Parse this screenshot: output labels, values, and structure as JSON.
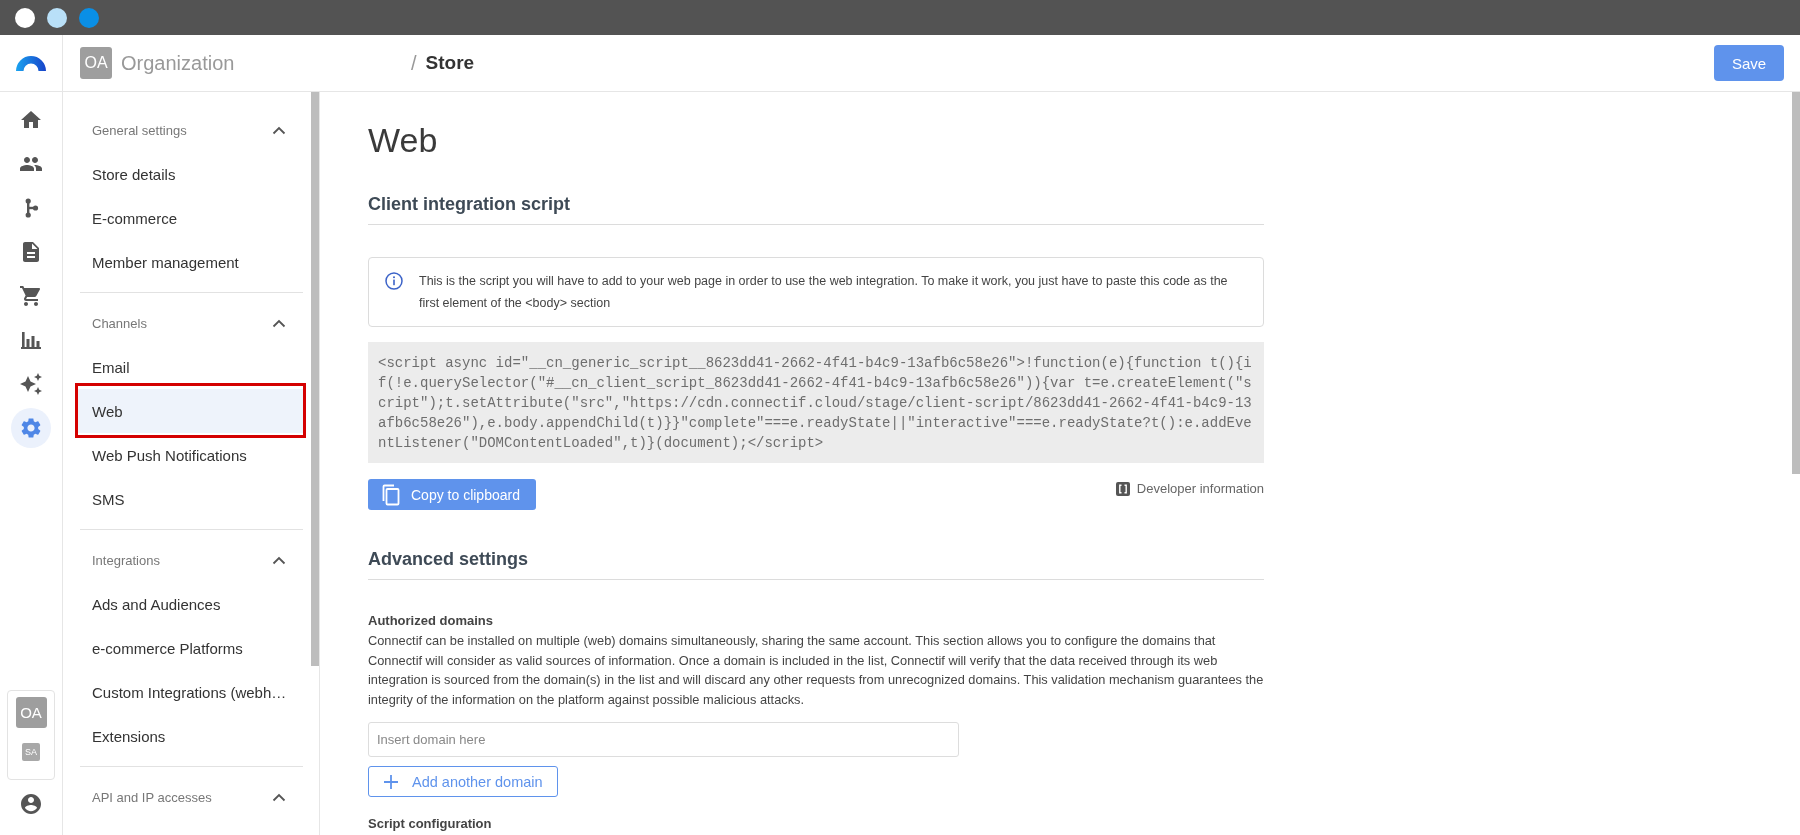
{
  "window": {
    "controls": [
      {
        "color": "#ffffff"
      },
      {
        "color": "#b9e0f8"
      },
      {
        "color": "#0a8fe6"
      }
    ]
  },
  "nav_rail": {
    "items": [
      {
        "selected": false
      },
      {
        "selected": false
      },
      {
        "selected": false
      },
      {
        "selected": false
      },
      {
        "selected": false
      },
      {
        "selected": false
      },
      {
        "selected": false
      },
      {
        "selected": true
      }
    ],
    "account": {
      "organization_initials": "OA",
      "user_initials": "SA"
    }
  },
  "header": {
    "organization": {
      "initials": "OA",
      "name": "Organization"
    },
    "breadcrumb": {
      "separator": "/",
      "current": "Store"
    },
    "save_button": "Save"
  },
  "sidebar": {
    "sections": [
      {
        "title": "General settings",
        "expanded": true,
        "items": [
          {
            "label": "Store details",
            "selected": false,
            "highlighted": false
          },
          {
            "label": "E-commerce",
            "selected": false,
            "highlighted": false
          },
          {
            "label": "Member management",
            "selected": false,
            "highlighted": false
          }
        ]
      },
      {
        "title": "Channels",
        "expanded": true,
        "items": [
          {
            "label": "Email",
            "selected": false,
            "highlighted": false
          },
          {
            "label": "Web",
            "selected": true,
            "highlighted": true
          },
          {
            "label": "Web Push Notifications",
            "selected": false,
            "highlighted": false
          },
          {
            "label": "SMS",
            "selected": false,
            "highlighted": false
          }
        ]
      },
      {
        "title": "Integrations",
        "expanded": true,
        "items": [
          {
            "label": "Ads and Audiences",
            "selected": false,
            "highlighted": false
          },
          {
            "label": "e-commerce Platforms",
            "selected": false,
            "highlighted": false
          },
          {
            "label": "Custom Integrations (webh…",
            "selected": false,
            "highlighted": false
          },
          {
            "label": "Extensions",
            "selected": false,
            "highlighted": false
          }
        ]
      },
      {
        "title": "API and IP accesses",
        "expanded": true
      }
    ]
  },
  "content": {
    "title": "Web",
    "client_script": {
      "heading": "Client integration script",
      "info": "This is the script you will have to add to your web page in order to use the web integration. To make it work, you just have to paste this code as the first element of the <body> section",
      "code": "<script async id=\"__cn_generic_script__8623dd41-2662-4f41-b4c9-13afb6c58e26\">!function(e){function t(){if(!e.querySelector(\"#__cn_client_script_8623dd41-2662-4f41-b4c9-13afb6c58e26\")){var t=e.createElement(\"script\");t.setAttribute(\"src\",\"https://cdn.connectif.cloud/stage/client-script/8623dd41-2662-4f41-b4c9-13afb6c58e26\"),e.body.appendChild(t)}}\"complete\"===e.readyState||\"interactive\"===e.readyState?t():e.addEventListener(\"DOMContentLoaded\",t)}(document);</script>",
      "copy_button": "Copy to clipboard",
      "developer_link": "Developer information"
    },
    "advanced": {
      "heading": "Advanced settings",
      "authorized_domains": {
        "label": "Authorized domains",
        "description": "Connectif can be installed on multiple (web) domains simultaneously, sharing the same account. This section allows you to configure the domains that Connectif will consider as valid sources of information. Once a domain is included in the list, Connectif will verify that the data received through its web integration is sourced from the domain(s) in the list and will discard any other requests from unrecognized domains. This validation mechanism guarantees the integrity of the information on the platform against possible malicious attacks.",
        "domain_field": {
          "placeholder": "Insert domain here"
        },
        "add_button": "Add another domain"
      },
      "script_configuration": {
        "label": "Script configuration"
      }
    }
  }
}
